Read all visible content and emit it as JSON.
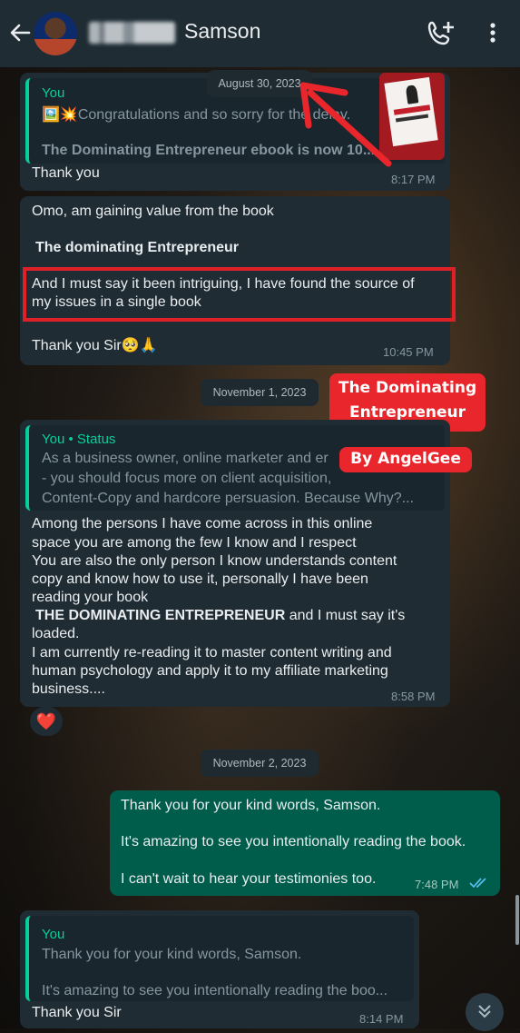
{
  "header": {
    "contact_name": "Samson"
  },
  "dates": [
    "August 30, 2023",
    "November 1, 2023",
    "November 2, 2023"
  ],
  "overlay_labels": {
    "title_line1": "The Dominating",
    "title_line2": "Entrepreneur",
    "byline": "By AngelGee"
  },
  "messages": [
    {
      "quote_sender": "You",
      "quote_line1": "🖼️💥Congratulations and so sorry for the delay.",
      "quote_line2": "The Dominating Entrepreneur ebook is now 10...",
      "text": "Thank you",
      "time": "8:17 PM"
    },
    {
      "line1": "Omo, am gaining value from the book",
      "line2": "The dominating Entrepreneur",
      "line3": "And I must say it been intriguing, I have found the source of",
      "line4": "my issues in a single book",
      "line5": "Thank you Sir🥺🙏",
      "time": "10:45 PM"
    },
    {
      "quote_sender": "You",
      "quote_status": "Status",
      "quote_lines": [
        "As a business owner, online marketer and er",
        "- you should focus more on client acquisition,",
        "Content-Copy and hardcore persuasion. Because Why?..."
      ],
      "lines": [
        "Among the persons I have come across in this online",
        "space you are among the few I know and I respect",
        "You are also the only person I know understands content",
        "copy and know how to use it, personally I have been",
        "reading your book"
      ],
      "bold_part": "THE DOMINATING ENTREPRENEUR",
      "after_bold": " and I must say it's",
      "lines2": [
        "loaded.",
        "I am currently re-reading it to master content writing and",
        "human psychology and apply it to my affiliate marketing",
        "business...."
      ],
      "time": "8:58 PM",
      "reaction": "❤️"
    },
    {
      "lines": [
        "Thank you for your kind words, Samson.",
        "It's amazing to see you intentionally reading the book.",
        "I can't wait to hear your testimonies too."
      ],
      "time": "7:48 PM"
    },
    {
      "quote_sender": "You",
      "quote_line1": "Thank you for your kind words, Samson.",
      "quote_line2": "It's amazing to see you intentionally reading the boo...",
      "text": "Thank you Sir",
      "time": "8:14 PM"
    }
  ]
}
